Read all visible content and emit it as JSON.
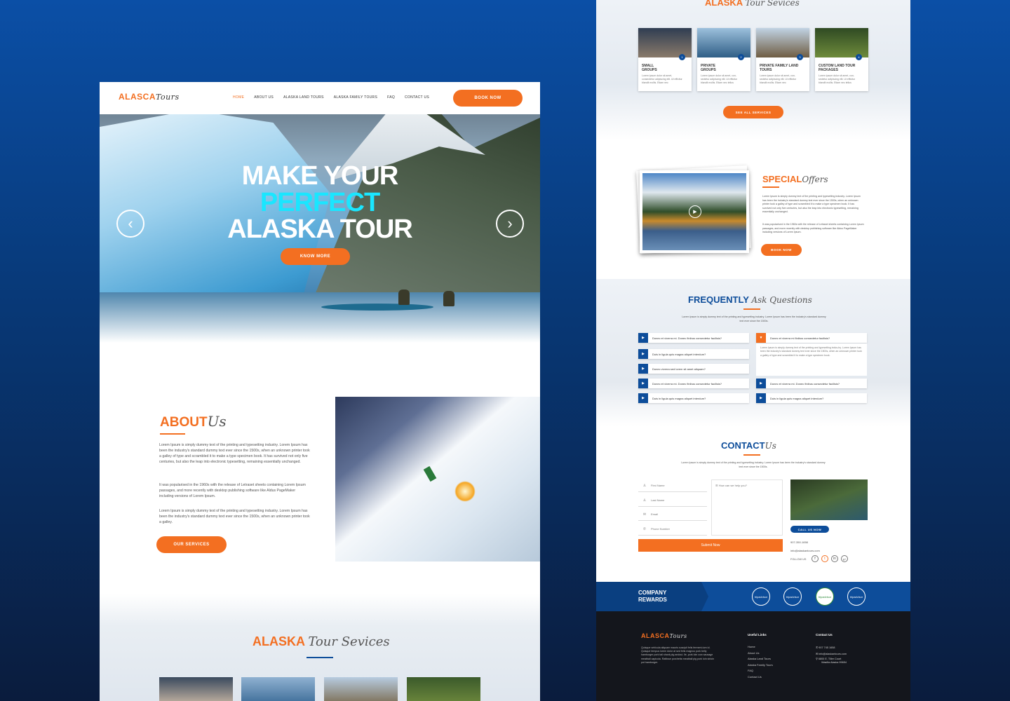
{
  "left": {
    "logo": {
      "brand": "ALASCA",
      "script": "Tours"
    },
    "nav": [
      "HOME",
      "ABOUT US",
      "ALASKA LAND TOURS",
      "ALASKA FAMILY TOURS",
      "FAQ",
      "CONTACT US"
    ],
    "book_now": "BOOK NOW",
    "hero": {
      "line1": "MAKE YOUR",
      "line2": "PERFECT",
      "line3": "ALASKA TOUR",
      "cta": "KNOW MORE",
      "prev_icon": "arrow-left-icon",
      "next_icon": "arrow-right-icon"
    },
    "about": {
      "title": "ABOUT",
      "script": "Us",
      "p1": "Lorem Ipsum is simply dummy text of the printing and typesetting industry. Lorem Ipsum has been the industry's standard dummy text ever since the 1500s, when an unknown printer took a galley of type and scrambled it to make a type specimen book. It has survived not only five centuries, but also the leap into electronic typesetting, remaining essentially unchanged.",
      "p2": "It was popularised in the 1960s with the release of Letraset sheets containing Lorem Ipsum passages, and more recently with desktop publishing software like Aldus PageMaker including versions of Lorem Ipsum.",
      "p3": "Lorem Ipsum is simply dummy text of the printing and typesetting industry. Lorem Ipsum has been the industry's standard dummy text ever since the 1500s, when an unknown printer took a galley.",
      "cta": "OUR SERVICES"
    },
    "services": {
      "title": "ALASKA",
      "script": "Tour Sevices"
    }
  },
  "right": {
    "services": {
      "title": "ALASKA",
      "script": "Tour Sevices",
      "cards": [
        {
          "num": "1",
          "title": "SMALL GROUPS",
          "text": "Lorem ipsum dolor sit amet, consectetur adipiscing elit. Ut efficitur blandit mollis. Etiam nec"
        },
        {
          "num": "2",
          "title": "PRIVATE GROUPS",
          "text": "Lorem ipsum dolor sit amet, con-sectetur adipiscing elit. Ut efficitur blandit mollis. Etiam nec tellus"
        },
        {
          "num": "3",
          "title": "PRIVATE FAMILY LAND TOURS",
          "text": "Lorem ipsum dolor sit amet, con-sectetur adipiscing elit. Ut efficitur blandit mollis. Etiam nec"
        },
        {
          "num": "4",
          "title": "CUSTOM LAND TOUR PACKAGES",
          "text": "Lorem ipsum dolor sit amet, con-sectetur adipiscing elit. Ut efficitur blandit mollis. Etiam nec tellus"
        }
      ],
      "cta": "SEE ALL SERVICES"
    },
    "special": {
      "title": "SPECIAL",
      "script": "Offers",
      "p1": "Lorem Ipsum is simply dummy text of the printing and typesetting industry. Lorem Ipsum has been the industry's standard dummy text ever since the 1500s, when an unknown printer took a galley of type and scrambled it to make a type specimen book. It has survived not only five centuries, but also the leap into electronic typesetting, remaining essentially unchanged.",
      "p2": "It was popularised in the 1960s with the release of Letraset sheets containing Lorem Ipsum passages, and more recently with desktop publishing software like Aldus PageMaker including versions of Lorem Ipsum.",
      "cta": "BOOK NOW"
    },
    "faq": {
      "title": "FREQUENTLY",
      "script": "Ask Questions",
      "intro": "Lorem Ipsum is simply dummy text of the printing and typesetting industry. Lorem Ipsum has been the industry's standard dummy text ever since the 1500s.",
      "left": [
        "Donec et viverra mi. Donec finibus consectetur facilisis?",
        "Duis in ligula quis magna aliquet interdum?",
        "Donec viverra sed lorem sit amet aliquam?",
        "Donec et viverra mi. Donec finibus consectetur facilisis?",
        "Duis in ligula quis magna aliquet interdum?"
      ],
      "open_q": "Donec et viverra mi finibus consectetur facilisis?",
      "open_a": "Lorem Ipsum is simply dummy text of the printing and typesetting indus-try. Lorem Ipsum has been the industry's standard dummy text ever since the 1500s, when an unknown printer took a galley of type and scrambled it to make a type specimen book.",
      "right": [
        "Donec et viverra mi. Donec finibus consectetur facilisis?",
        "Duis in ligula quis magna aliquet interdum?"
      ]
    },
    "contact": {
      "title": "CONTACT",
      "script": "Us",
      "intro": "Lorem Ipsum is simply dummy text of the printing and typesetting industry. Lorem Ipsum has been the industry's standard dummy text ever since the 1500s.",
      "fields": [
        "First Name",
        "Last Name",
        "Email",
        "Phone Number"
      ],
      "message_placeholder": "How can we help you?",
      "submit": "Submit Now",
      "call": "CALL US NOW",
      "phone": "907-350-1658",
      "email": "info@alaskantours.com",
      "follow": "FOLLOW US"
    },
    "rewards": {
      "label1": "COMPANY",
      "label2": "REWARDS",
      "badges": [
        "tripadvisor",
        "tripadvisor",
        "tripadvisor",
        "tripadvisor"
      ]
    },
    "footer": {
      "logo": {
        "brand": "ALASCA",
        "script": "Tours"
      },
      "text": "Quisque vehicula aliquam mauris suscipit felis ferment-tum id. Quisque tempus lorem dolor at sed fells magnus pork belly hamburger pork tail shank pig andoui. lle, pork loin cow sausage meatball capicola. Rattisse porchetta meatball pig pork loin sirloin pot hamburger.",
      "useful_title": "Useful Links",
      "links": [
        "Home",
        "About Us",
        "Alaska Land Tours",
        "Alaska Family Tours",
        "FAQ",
        "Contact Us"
      ],
      "contact_title": "Contact Us",
      "phone": "907 745 1658",
      "email": "info@alaskantours.com",
      "address1": "6800 E. Tiller Court",
      "address2": "Wasilla Alaska 99654"
    }
  },
  "colors": {
    "orange": "#f36f21",
    "blue": "#0d4d9a",
    "cyan": "#1ae6ff"
  }
}
